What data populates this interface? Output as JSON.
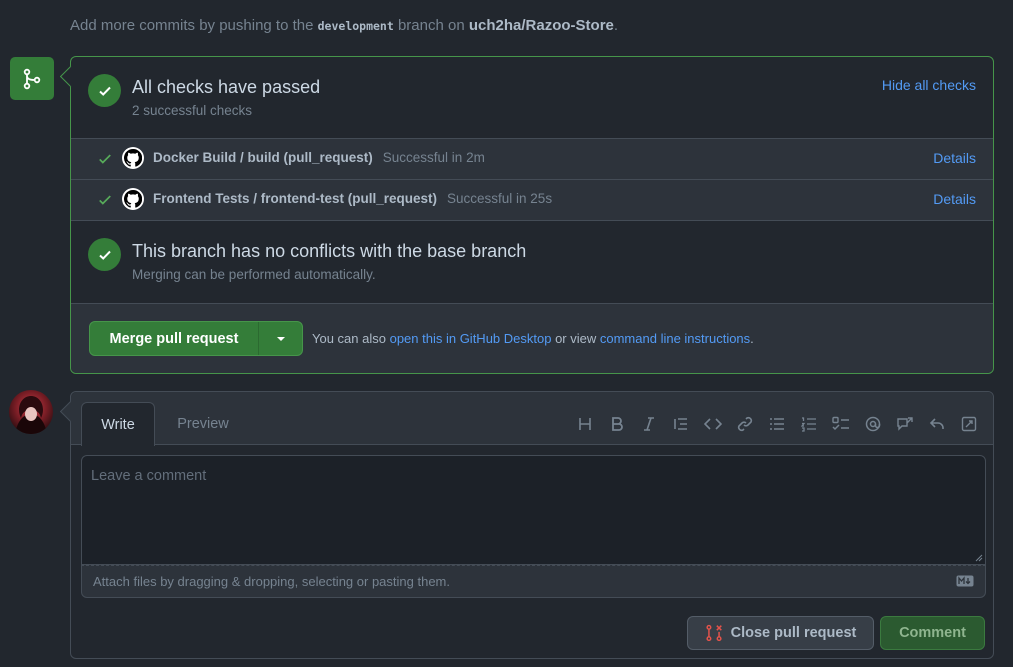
{
  "hint": {
    "prefix": "Add more commits by pushing to the ",
    "branch": "development",
    "middle": " branch on ",
    "repo": "uch2ha/Razoo-Store",
    "suffix": "."
  },
  "checks": {
    "title": "All checks have passed",
    "subtitle": "2 successful checks",
    "hide_label": "Hide all checks",
    "items": [
      {
        "name": "Docker Build / build (pull_request)",
        "status": "Successful in 2m",
        "details": "Details"
      },
      {
        "name": "Frontend Tests / frontend-test (pull_request)",
        "status": "Successful in 25s",
        "details": "Details"
      }
    ]
  },
  "conflicts": {
    "title": "This branch has no conflicts with the base branch",
    "subtitle": "Merging can be performed automatically."
  },
  "merge": {
    "button_label": "Merge pull request",
    "also_prefix": "You can also ",
    "desktop_link": "open this in GitHub Desktop",
    "also_middle": " or view ",
    "cli_link": "command line instructions",
    "also_suffix": "."
  },
  "comment": {
    "tab_write": "Write",
    "tab_preview": "Preview",
    "placeholder": "Leave a comment",
    "attach_text": "Attach files by dragging & dropping, selecting or pasting them.",
    "close_label": "Close pull request",
    "comment_label": "Comment"
  },
  "colors": {
    "success": "#347d39",
    "link": "#539bf5",
    "background": "#22272e"
  }
}
